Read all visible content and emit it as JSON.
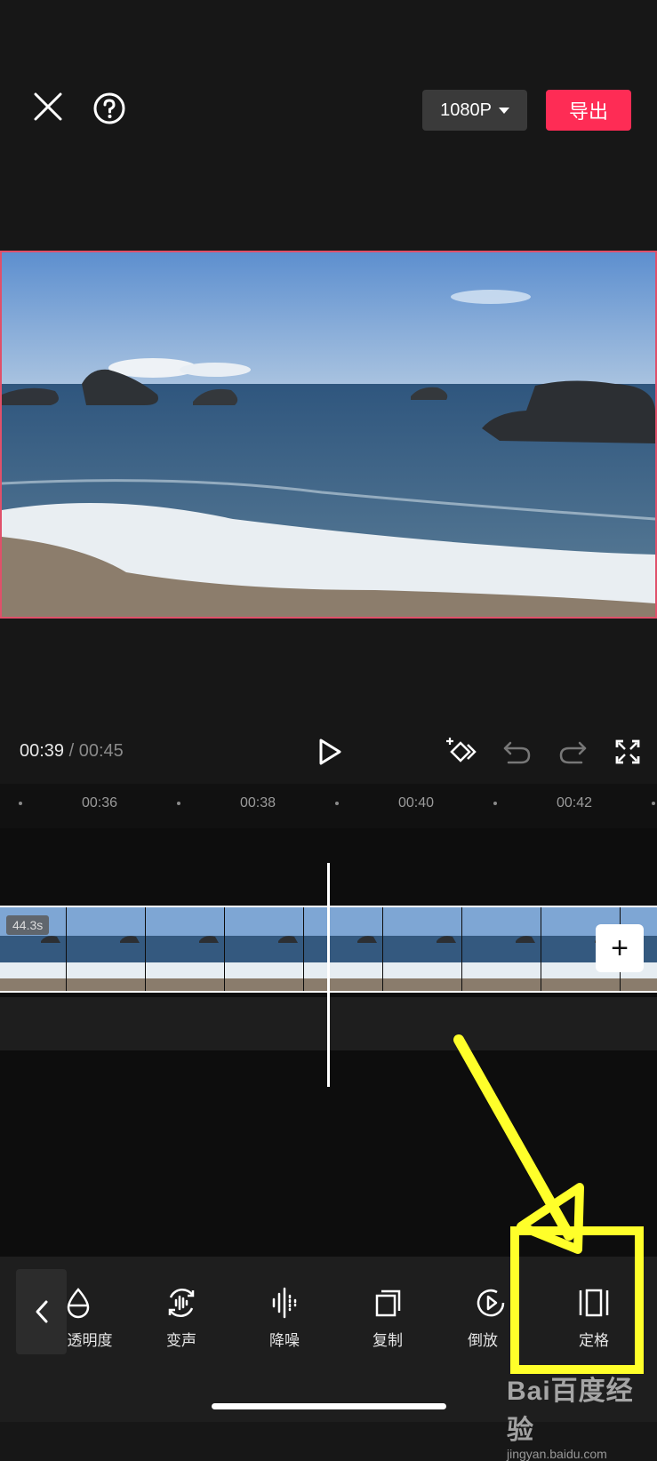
{
  "header": {
    "resolution": "1080P",
    "export_label": "导出"
  },
  "player": {
    "current_time": "00:39",
    "separator": "/",
    "total_time": "00:45"
  },
  "timeline": {
    "ticks": [
      "00:36",
      "00:38",
      "00:40",
      "00:42"
    ],
    "clip_duration": "44.3s",
    "add_clip_label": "+"
  },
  "toolbar": {
    "items": [
      {
        "label": "透明度",
        "icon": "opacity-drop-icon"
      },
      {
        "label": "变声",
        "icon": "voice-change-icon"
      },
      {
        "label": "降噪",
        "icon": "noise-reduction-icon"
      },
      {
        "label": "复制",
        "icon": "copy-icon"
      },
      {
        "label": "倒放",
        "icon": "reverse-play-icon"
      },
      {
        "label": "定格",
        "icon": "freeze-frame-icon"
      }
    ]
  },
  "watermark": {
    "logo": "Bai百度经验",
    "url": "jingyan.baidu.com"
  },
  "colors": {
    "accent": "#fe2c55",
    "highlight": "#ffff2a",
    "background": "#171717"
  }
}
